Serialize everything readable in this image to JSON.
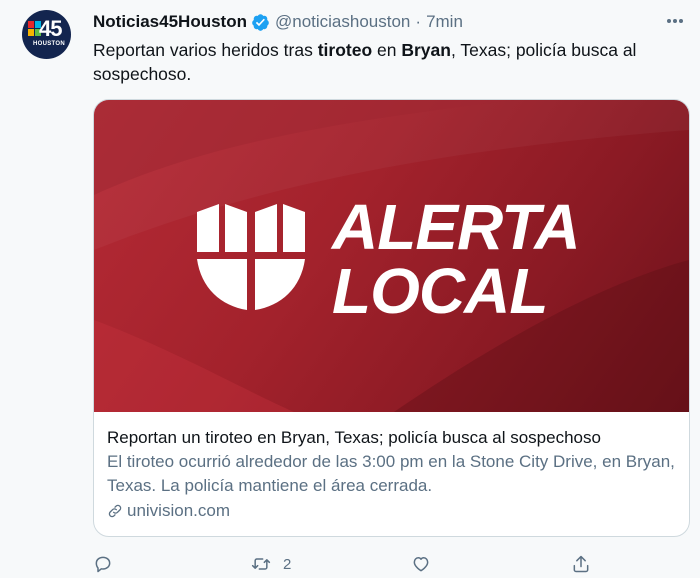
{
  "tweet": {
    "avatar": {
      "number": "45",
      "caption": "HOUSTON",
      "icon": "univision-logo"
    },
    "author_name": "Noticias45Houston",
    "verified_icon": "verified-badge-icon",
    "handle": "@noticiashouston",
    "separator": "·",
    "time": "7min",
    "more_icon": "more-options-icon",
    "text_parts": [
      "Reportan varios heridos tras ",
      "tiroteo",
      " en ",
      "Bryan",
      ", Texas; policía busca al sospechoso."
    ]
  },
  "card": {
    "image": {
      "line1": "ALERTA",
      "line2": "LOCAL",
      "logo": "univision-shield-logo"
    },
    "title": "Reportan un tiroteo en Bryan, Texas; policía busca al sospechoso",
    "description": "El tiroteo ocurrió alrededor de las 3:00 pm en la Stone City Drive, en Bryan, Texas. La policía mantiene el área cerrada.",
    "link_icon": "link-icon",
    "domain": "univision.com"
  },
  "actions": {
    "reply_icon": "reply-icon",
    "retweet_icon": "retweet-icon",
    "retweet_count": "2",
    "like_icon": "like-icon",
    "share_icon": "share-icon"
  },
  "colors": {
    "background": "#f7f9fa",
    "card_red": "#a3222c",
    "secondary_text": "#5b7083",
    "verified_blue": "#1da1f2",
    "avatar_navy": "#13254f"
  }
}
